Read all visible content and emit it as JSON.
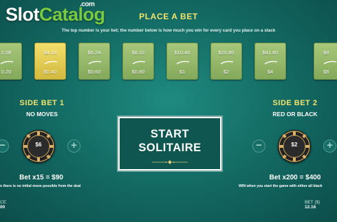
{
  "logo": {
    "part1": "Slot",
    "part2": "Catalog",
    "suffix": ".com"
  },
  "header": {
    "title": "PLACE A BET",
    "subtitle": "The top number is your bet; the number below is how much you win for every card you place on a stack"
  },
  "bet_cards": [
    {
      "bet": "2.08",
      "win": "0.20",
      "selected": false
    },
    {
      "bet": "$4.16",
      "win": "$0.40",
      "selected": true
    },
    {
      "bet": "$6.24",
      "win": "$0.60",
      "selected": false
    },
    {
      "bet": "$8.32",
      "win": "$0.80",
      "selected": false
    },
    {
      "bet": "$10.40",
      "win": "$1",
      "selected": false
    },
    {
      "bet": "$20.80",
      "win": "$2",
      "selected": false
    },
    {
      "bet": "$41.60",
      "win": "$4",
      "selected": false
    },
    {
      "bet": "$8",
      "win": "$8",
      "selected": false
    }
  ],
  "side_bet_1": {
    "title": "SIDE BET 1",
    "subtitle": "NO MOVES",
    "chip_value": "$6",
    "bet_line": "Bet x15 = $90",
    "description": "n there is no initial move possible from the deal"
  },
  "side_bet_2": {
    "title": "SIDE BET 2",
    "subtitle": "RED OR BLACK",
    "chip_value": "$2",
    "bet_line": "Bet x200 = $400",
    "description": "WIN when you start the game with either all black"
  },
  "start_button": {
    "line1": "START",
    "line2": "SOLITAIRE"
  },
  "footer": {
    "left_label": "CE",
    "left_value": "00",
    "right_label": "BET ($)",
    "right_value": "12.16"
  },
  "colors": {
    "accent_gold": "#f2e36b",
    "felt": "#146d66",
    "card_green": "#a7c779",
    "card_selected": "#f2e06c"
  }
}
